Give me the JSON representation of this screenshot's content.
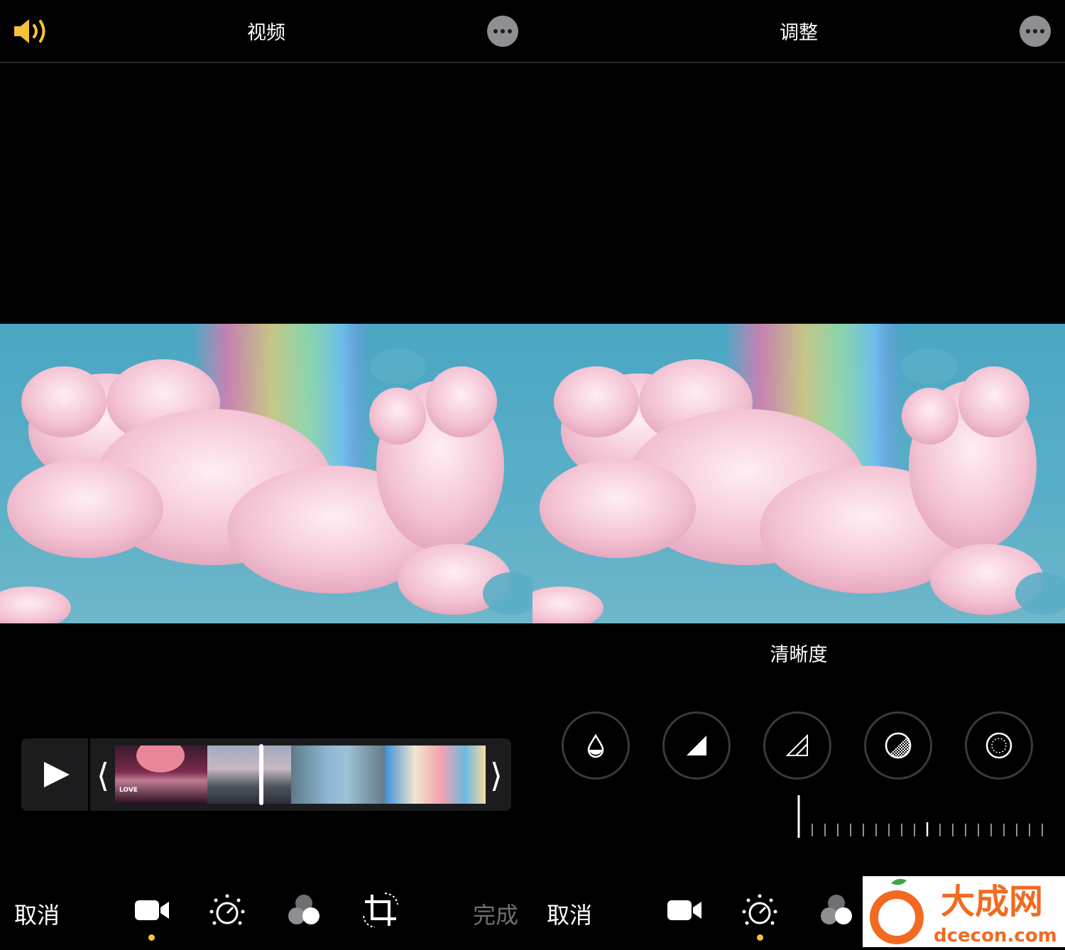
{
  "left_panel": {
    "title": "视频",
    "timeline": {
      "open_bracket": "⟨",
      "close_bracket": "⟩",
      "first_clip_text": "LOVE"
    },
    "bottom_bar": {
      "cancel_label": "取消",
      "done_label": "完成",
      "tools": [
        "video-icon",
        "adjust-dial-icon",
        "filters-icon",
        "crop-rotate-icon"
      ],
      "active_tool": "video-icon"
    }
  },
  "right_panel": {
    "title": "调整",
    "adjustment_name": "清晰度",
    "adjustment_tools": [
      "brilliance-drop-icon",
      "contrast-triangle-icon",
      "contrast-outline-triangle-icon",
      "black-point-icon",
      "vignette-icon"
    ],
    "bottom_bar": {
      "cancel_label": "取消",
      "tools": [
        "video-icon",
        "adjust-dial-icon",
        "filters-icon"
      ],
      "active_tool": "adjust-dial-icon"
    }
  },
  "watermark": {
    "brand": "大成网",
    "domain": "dcecon.com"
  },
  "colors": {
    "accent": "#f5c33b",
    "sky": "#4aa6c3",
    "cloud": "#f2c7d5",
    "disabled": "#6e6e6e"
  }
}
